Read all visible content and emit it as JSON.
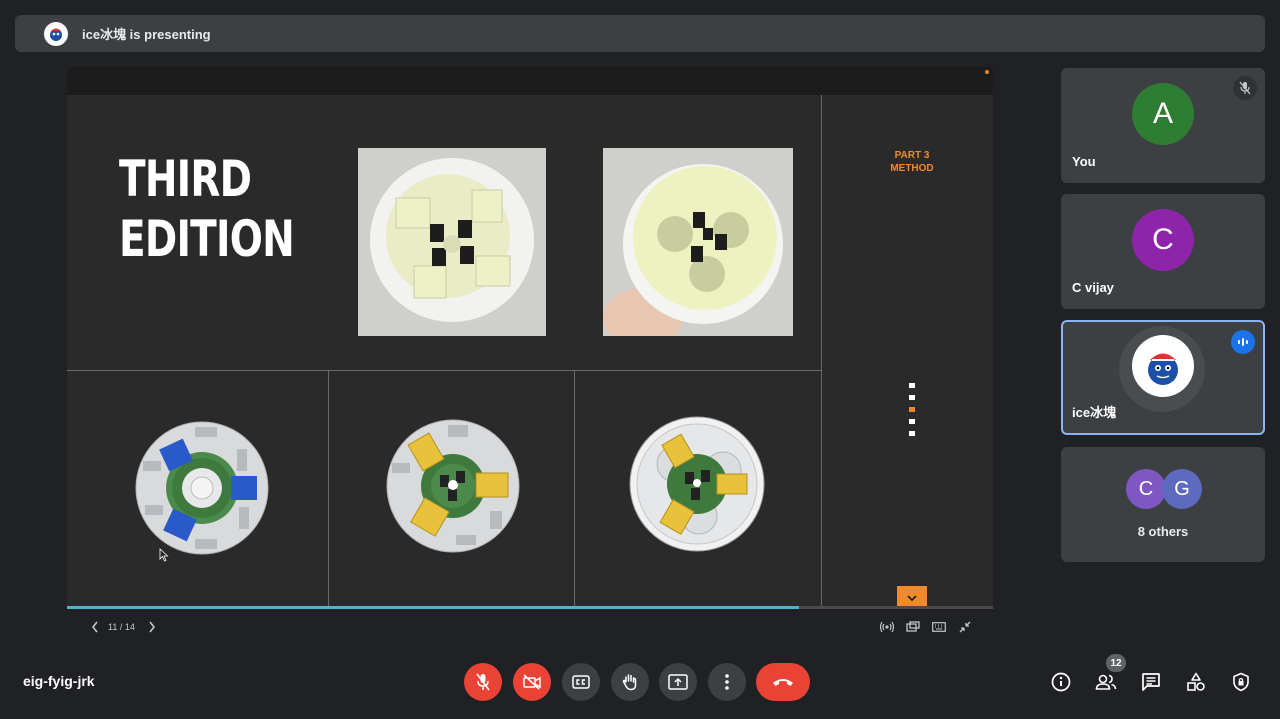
{
  "banner": {
    "text": "ice冰塊 is presenting",
    "avatar_icon": "character-avatar-icon"
  },
  "slide": {
    "title_line1": "THIRD",
    "title_line2": "EDITION",
    "part_line1": "PART 3",
    "part_line2": "METHOD",
    "accent_color": "#f08a2c",
    "nav_dots_count": 5,
    "active_nav_dot": 3
  },
  "slide_controls": {
    "page_indicator": "11 / 14",
    "current_page": 11,
    "total_pages": 14,
    "progress_fraction": 0.79
  },
  "participants": [
    {
      "name": "You",
      "initial": "A",
      "color": "#2e7d32",
      "muted": true
    },
    {
      "name": "C vijay",
      "initial": "C",
      "color": "#8e24aa"
    },
    {
      "name": "ice冰塊",
      "speaking": true
    },
    {
      "others_initials": [
        "C",
        "G"
      ],
      "others_colors": [
        "#7e57c2",
        "#5c6bc0"
      ],
      "label": "8 others"
    }
  ],
  "bottom_bar": {
    "meeting_code": "eig-fyig-jrk",
    "participant_count": "12"
  },
  "colors": {
    "background": "#202124",
    "tile": "#3c4043",
    "danger": "#ea4335",
    "active_border": "#8ab4f8"
  }
}
